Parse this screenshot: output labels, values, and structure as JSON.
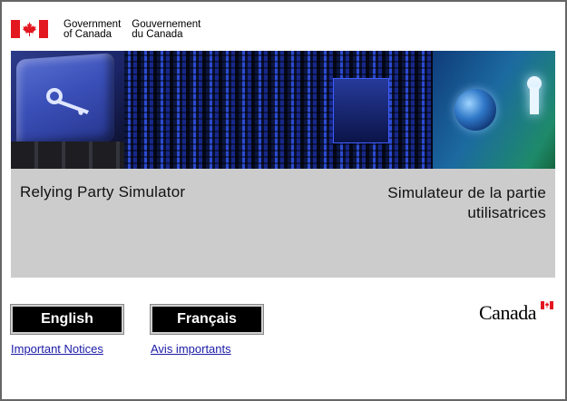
{
  "signature": {
    "en": "Government\nof Canada",
    "fr": "Gouvernement\ndu Canada",
    "flag_red": "#e3171f"
  },
  "title": {
    "en": "Relying Party Simulator",
    "fr": "Simulateur de la partie utilisatrices"
  },
  "buttons": {
    "english": "English",
    "french": "Français"
  },
  "links": {
    "notices_en": "Important Notices",
    "notices_fr": "Avis importants"
  },
  "wordmark": "Canada",
  "colors": {
    "band": "#cccccc",
    "link": "#1a1aa6",
    "button_bg": "#000000"
  }
}
